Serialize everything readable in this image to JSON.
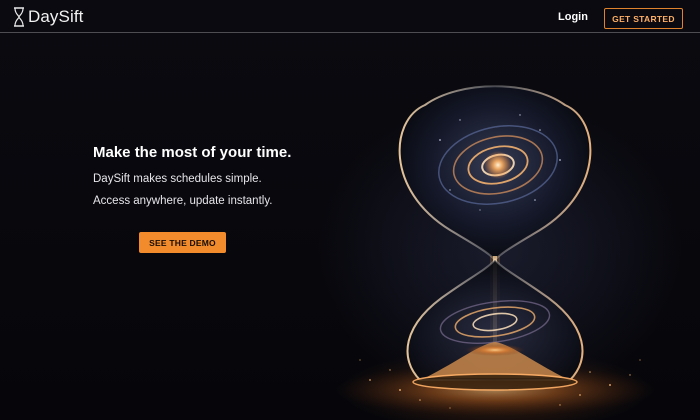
{
  "header": {
    "brand": "DaySift",
    "login_label": "Login",
    "get_started_label": "GET STARTED",
    "accent_color": "#f28b2c"
  },
  "hero": {
    "title": "Make the most of your time.",
    "lines": [
      "DaySift makes schedules simple.",
      "Access anywhere, update instantly."
    ],
    "cta_label": "SEE THE DEMO"
  },
  "illustration": {
    "icon": "hourglass-galaxy-illustration"
  }
}
